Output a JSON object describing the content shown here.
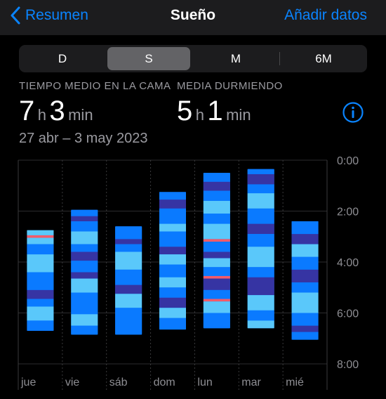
{
  "nav": {
    "back_label": "Resumen",
    "title": "Sueño",
    "action_label": "Añadir datos"
  },
  "segments": [
    {
      "label": "D",
      "selected": false
    },
    {
      "label": "S",
      "selected": true
    },
    {
      "label": "M",
      "selected": false
    },
    {
      "label": "6M",
      "selected": false
    }
  ],
  "stats": {
    "in_bed": {
      "label": "TIEMPO MEDIO EN LA CAMA",
      "hours": "7",
      "hours_unit": "h",
      "minutes": "3",
      "minutes_unit": "min"
    },
    "asleep": {
      "label": "MEDIA DURMIENDO",
      "hours": "5",
      "hours_unit": "h",
      "minutes": "1",
      "minutes_unit": "min"
    },
    "date_range": "27 abr – 3 may 2023"
  },
  "colors": {
    "background": "#000000",
    "accent": "#0a84ff",
    "awake": "#f45b69",
    "rem": "#5ac8fa",
    "core": "#0a7aff",
    "deep": "#3634a3"
  },
  "chart_data": {
    "type": "bar",
    "orientation": "vertical-time-ranges",
    "categories": [
      "jue",
      "vie",
      "sáb",
      "dom",
      "lun",
      "mar",
      "mié"
    ],
    "y_tick_labels": [
      "0:00",
      "2:00",
      "4:00",
      "6:00",
      "8:00"
    ],
    "ylim": [
      0,
      8
    ],
    "y_reversed": true,
    "stages": [
      "awake",
      "rem",
      "core",
      "deep"
    ],
    "days": [
      {
        "day": "jue",
        "start": 2.75,
        "end": 6.7,
        "segments": [
          [
            2.75,
            2.95,
            "rem"
          ],
          [
            2.95,
            3.05,
            "awake"
          ],
          [
            3.05,
            3.3,
            "rem"
          ],
          [
            3.3,
            3.7,
            "core"
          ],
          [
            3.7,
            4.4,
            "rem"
          ],
          [
            4.4,
            4.7,
            "core"
          ],
          [
            4.7,
            5.1,
            "core"
          ],
          [
            5.1,
            5.45,
            "deep"
          ],
          [
            5.45,
            5.75,
            "core"
          ],
          [
            5.75,
            6.3,
            "rem"
          ],
          [
            6.3,
            6.7,
            "core"
          ]
        ]
      },
      {
        "day": "vie",
        "start": 1.95,
        "end": 6.85,
        "segments": [
          [
            1.95,
            2.2,
            "core"
          ],
          [
            2.2,
            2.4,
            "deep"
          ],
          [
            2.4,
            2.8,
            "core"
          ],
          [
            2.8,
            3.3,
            "rem"
          ],
          [
            3.3,
            3.6,
            "core"
          ],
          [
            3.6,
            3.95,
            "deep"
          ],
          [
            3.95,
            4.4,
            "core"
          ],
          [
            4.4,
            4.65,
            "deep"
          ],
          [
            4.65,
            5.2,
            "rem"
          ],
          [
            5.2,
            6.05,
            "core"
          ],
          [
            6.05,
            6.5,
            "rem"
          ],
          [
            6.5,
            6.85,
            "core"
          ]
        ]
      },
      {
        "day": "sáb",
        "start": 2.6,
        "end": 6.85,
        "segments": [
          [
            2.6,
            3.1,
            "core"
          ],
          [
            3.1,
            3.3,
            "deep"
          ],
          [
            3.3,
            3.6,
            "core"
          ],
          [
            3.6,
            4.3,
            "rem"
          ],
          [
            4.3,
            4.9,
            "core"
          ],
          [
            4.9,
            5.25,
            "deep"
          ],
          [
            5.25,
            5.8,
            "rem"
          ],
          [
            5.8,
            6.25,
            "core"
          ],
          [
            6.25,
            6.85,
            "core"
          ]
        ]
      },
      {
        "day": "dom",
        "start": 1.25,
        "end": 6.65,
        "segments": [
          [
            1.25,
            1.55,
            "core"
          ],
          [
            1.55,
            1.9,
            "deep"
          ],
          [
            1.9,
            2.5,
            "core"
          ],
          [
            2.5,
            2.8,
            "rem"
          ],
          [
            2.8,
            3.4,
            "core"
          ],
          [
            3.4,
            3.7,
            "deep"
          ],
          [
            3.7,
            4.1,
            "rem"
          ],
          [
            4.1,
            4.6,
            "core"
          ],
          [
            4.6,
            5.0,
            "rem"
          ],
          [
            5.0,
            5.4,
            "core"
          ],
          [
            5.4,
            5.8,
            "deep"
          ],
          [
            5.8,
            6.2,
            "rem"
          ],
          [
            6.2,
            6.65,
            "core"
          ]
        ]
      },
      {
        "day": "lun",
        "start": 0.5,
        "end": 6.6,
        "segments": [
          [
            0.5,
            0.85,
            "core"
          ],
          [
            0.85,
            1.2,
            "deep"
          ],
          [
            1.2,
            1.6,
            "core"
          ],
          [
            1.6,
            2.1,
            "rem"
          ],
          [
            2.1,
            2.5,
            "core"
          ],
          [
            2.5,
            3.1,
            "rem"
          ],
          [
            3.1,
            3.2,
            "awake"
          ],
          [
            3.2,
            3.6,
            "core"
          ],
          [
            3.6,
            3.85,
            "deep"
          ],
          [
            3.85,
            4.2,
            "rem"
          ],
          [
            4.2,
            4.55,
            "core"
          ],
          [
            4.55,
            4.65,
            "awake"
          ],
          [
            4.65,
            5.1,
            "deep"
          ],
          [
            5.1,
            5.45,
            "core"
          ],
          [
            5.45,
            5.55,
            "awake"
          ],
          [
            5.55,
            6.0,
            "rem"
          ],
          [
            6.0,
            6.6,
            "core"
          ]
        ]
      },
      {
        "day": "mar",
        "start": 0.35,
        "end": 6.6,
        "segments": [
          [
            0.35,
            0.55,
            "core"
          ],
          [
            0.55,
            0.95,
            "deep"
          ],
          [
            0.95,
            1.3,
            "core"
          ],
          [
            1.3,
            1.9,
            "rem"
          ],
          [
            1.9,
            2.5,
            "core"
          ],
          [
            2.5,
            2.9,
            "deep"
          ],
          [
            2.9,
            3.4,
            "core"
          ],
          [
            3.4,
            4.2,
            "rem"
          ],
          [
            4.2,
            4.6,
            "core"
          ],
          [
            4.6,
            5.3,
            "deep"
          ],
          [
            5.3,
            5.9,
            "rem"
          ],
          [
            5.9,
            6.3,
            "core"
          ],
          [
            6.3,
            6.6,
            "rem"
          ]
        ]
      },
      {
        "day": "mié",
        "start": 2.4,
        "end": 7.05,
        "segments": [
          [
            2.4,
            2.9,
            "core"
          ],
          [
            2.9,
            3.3,
            "deep"
          ],
          [
            3.3,
            3.8,
            "rem"
          ],
          [
            3.8,
            4.3,
            "core"
          ],
          [
            4.3,
            4.8,
            "deep"
          ],
          [
            4.8,
            5.2,
            "core"
          ],
          [
            5.2,
            6.0,
            "rem"
          ],
          [
            6.0,
            6.5,
            "core"
          ],
          [
            6.5,
            6.75,
            "deep"
          ],
          [
            6.75,
            7.05,
            "core"
          ]
        ]
      }
    ]
  }
}
